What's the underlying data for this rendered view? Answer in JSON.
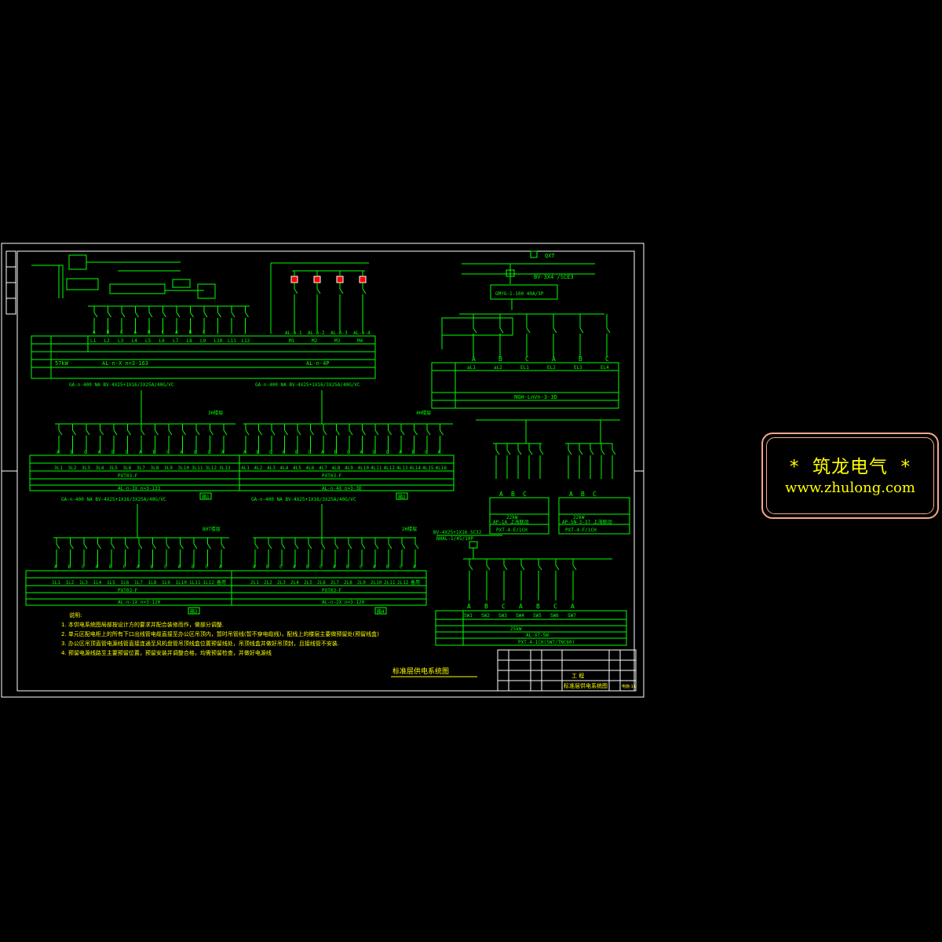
{
  "watermark": {
    "title": "*  筑龙电气  *",
    "url": "www.zhulong.com"
  },
  "drawing_title": "标准层供电系统图",
  "notes": {
    "heading": "说明:",
    "items": [
      "1. 本供电系统图局部按设计方的要求并配合装修而作，做部分调整.",
      "2. 单元区配电柜上的所有下口出线管电缆直接至办公区吊顶内，暂时吊管线(暂不穿电缆线)，配线上的楼层主要做预留处(预留线盒)",
      "3. 办公区吊顶直管电源线管直接连通至风机盘管吊顶线盒位置预留线处，吊顶线盒并做好吊顶封，且接线管不安装.",
      "4. 预留电源线路至主要预留位置，预留安装并调整合格，均需预留检查，并做好电源线"
    ]
  },
  "top_left": {
    "feeders": [
      "L1",
      "L2",
      "L3",
      "L4",
      "L5",
      "L6",
      "L7",
      "L8",
      "L9",
      "L10",
      "L11",
      "L12"
    ],
    "phases": [
      "A",
      "B",
      "C",
      "A",
      "B",
      "C",
      "A",
      "B",
      "C"
    ],
    "loads": [
      "M1",
      "M2",
      "M3",
      "M4"
    ],
    "load_circuits": [
      "AL-n-1",
      "AL-n-2",
      "AL-n-3",
      "AL-n-4"
    ],
    "voltage": "57kW",
    "cable": "AL-n-X n=3-163",
    "note": "AL-n-4P"
  },
  "top_right": {
    "meter": "QXT",
    "incoming": "BV-3X4 /SCE3",
    "breaker": "GMYG-1-100   40A/3P",
    "cols": [
      "A",
      "B",
      "C",
      "A",
      "B",
      "C"
    ],
    "circuits": [
      "aL1",
      "aL2",
      "EL1",
      "EL2",
      "EL3",
      "EL4"
    ],
    "model": "NGH-LnVn-3-3D"
  },
  "mid_left": {
    "header": "GA-n-400 NA BV-4X25+1X16/3X25A/40G/VC",
    "header2": "GA-n-400 NA BV-4X25+1X16/3X25A/40G/VC",
    "circuits_a": [
      "3L1",
      "3L2",
      "3L3",
      "3L4",
      "3L5",
      "3L6",
      "3L7",
      "3L8",
      "3L9",
      "3L10",
      "3L11",
      "3L12",
      "3L13"
    ],
    "circuits_b": [
      "4L1",
      "4L2",
      "4L3",
      "4L4",
      "4L5",
      "4L6",
      "4L7",
      "4L8",
      "4L9",
      "4L10",
      "4L11",
      "4L12",
      "4L13",
      "4L14",
      "4L15",
      "4L16"
    ],
    "panel_a": "PXT03-F",
    "panel_b": "PXT03-F",
    "cable_a": "AL-n-3X n=3-133",
    "cable_b": "AL-n-4X n=3-3D",
    "tag_a": "3H楼层",
    "tag_b": "4H楼层",
    "footer_a": "箱1",
    "footer_b": "箱2"
  },
  "mid_right": {
    "left": {
      "kw": "22kW",
      "box": "AP-1A   上海联动",
      "panel": "PXT-4-E/1CH",
      "phases": [
        "A",
        "B",
        "C"
      ]
    },
    "right": {
      "kw": "22kW",
      "box": "AP-5N-3-37  上海联动",
      "panel": "PXT-4-F/1CH",
      "phases": [
        "A",
        "B",
        "C"
      ]
    }
  },
  "bottom_left": {
    "header_a": "GA-n-400 NA BV-4X25+1X16/3X25A/40G/VC",
    "header_b": "GA-n-400 NA BV-4X25+1X16/3X25A/40G/VC",
    "circuits_a": [
      "1L1",
      "1L2",
      "1L3",
      "1L4",
      "1L5",
      "1L6",
      "1L7",
      "1L8",
      "1L9",
      "1L10",
      "1L11",
      "1L12",
      "备用"
    ],
    "circuits_b": [
      "2L1",
      "2L2",
      "2L3",
      "2L4",
      "2L5",
      "2L6",
      "2L7",
      "2L8",
      "2L9",
      "2L10",
      "2L11",
      "2L12",
      "备用"
    ],
    "panel_a": "PXT03-F",
    "panel_b": "PXT03-F",
    "cable_a": "AL-n-1X n=3-120",
    "cable_b": "AL-n-2X n=3-120",
    "tag_a": "B0T楼层",
    "tag_b": "2H楼层",
    "footer_a": "箱3",
    "footer_b": "箱4"
  },
  "bottom_right": {
    "header": "BV-4X25+1X16 SC32",
    "breaker": "NHAL-1/45/10P",
    "circuits": [
      "SW1",
      "SW2",
      "SW3",
      "SW4",
      "SW5",
      "SW6",
      "SW7"
    ],
    "kw": "25kW",
    "cable": "AL-X7-SW",
    "panel": "PXT-4-1CH(SW7/TNC60)"
  },
  "title_block": {
    "drawing_name": "标准层供电系统图",
    "project": "工  程",
    "sheet": "电施-11"
  }
}
